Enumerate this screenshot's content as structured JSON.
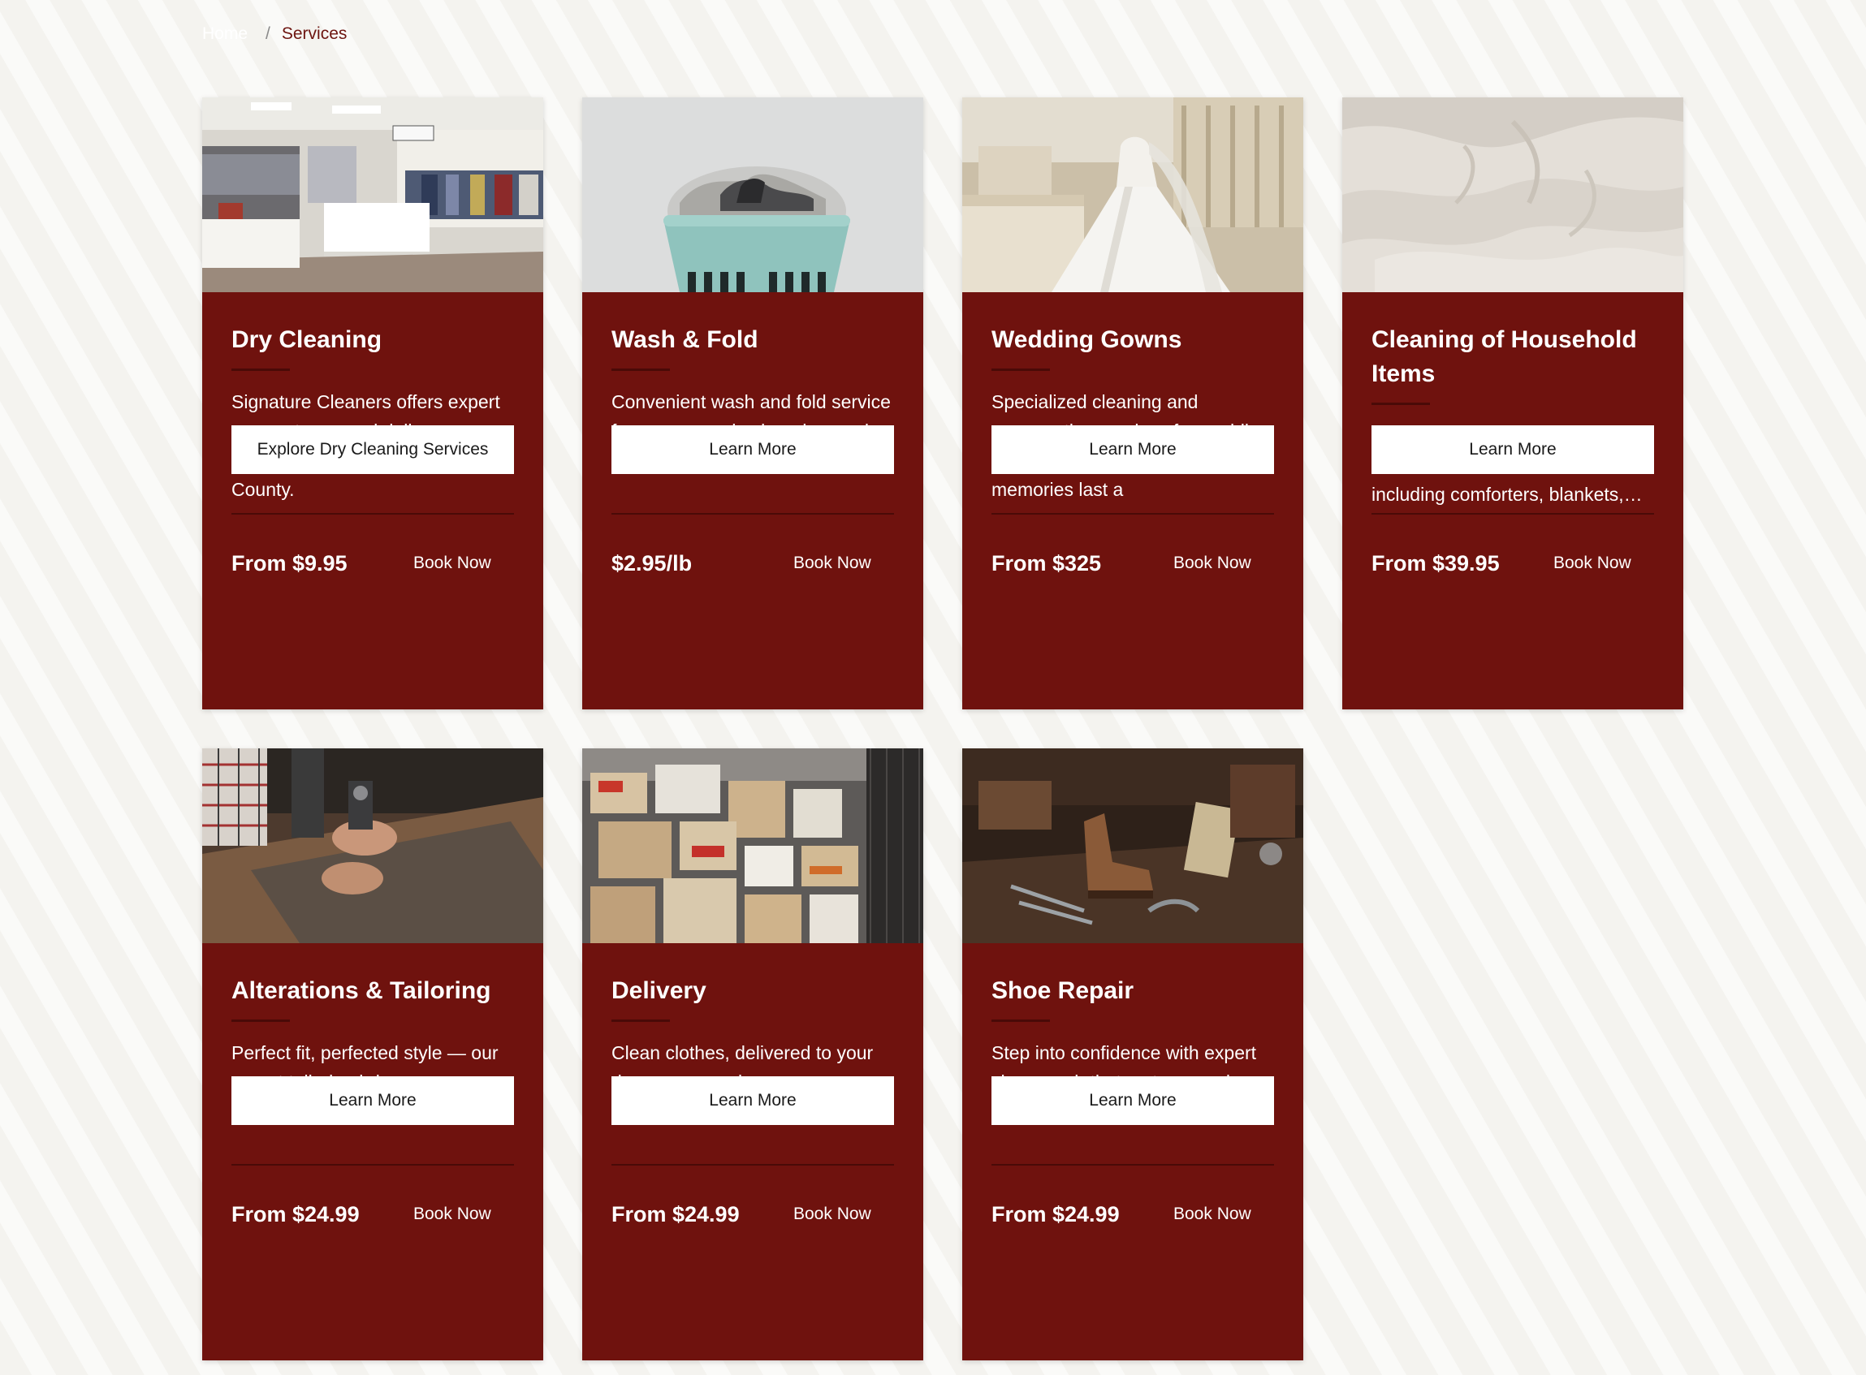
{
  "breadcrumb": {
    "home": "Home",
    "separator": "/",
    "current": "Services"
  },
  "colors": {
    "card_background": "#6f120e",
    "page_background": "#f4f3ef",
    "accent_text": "#6d1510"
  },
  "services": [
    {
      "title": "Dry Cleaning",
      "description": "Signature Cleaners offers expert garment care and delivery services throughout Bucks County.",
      "button_label": "Explore Dry Cleaning Services",
      "price": "From $9.95",
      "book_label": "Book Now",
      "image": "dry-cleaning-shop-photo"
    },
    {
      "title": "Wash & Fold",
      "description": "Convenient wash and fold service for your everyday laundry needs, saving you time and effort.",
      "button_label": "Learn More",
      "price": "$2.95/lb",
      "book_label": "Book Now",
      "image": "laundry-basket-photo"
    },
    {
      "title": "Wedding Gowns",
      "description": "Specialized cleaning and preservation services for wedding gowns, ensuring your precious memories last a",
      "button_label": "Learn More",
      "price": "From $325",
      "book_label": "Book Now",
      "image": "wedding-gown-photo"
    },
    {
      "title": "Cleaning of Household Items",
      "description": "Comprehensive cleaning solutions for household items including comforters, blankets, and more.",
      "button_label": "Learn More",
      "price": "From $39.95",
      "book_label": "Book Now",
      "image": "white-linen-photo"
    },
    {
      "title": "Alterations & Tailoring",
      "description": "Perfect fit, perfected style — our expert tailoring brings your garments to life.",
      "button_label": "Learn More",
      "price": "From $24.99",
      "book_label": "Book Now",
      "image": "tailoring-photo"
    },
    {
      "title": "Delivery",
      "description": "Clean clothes, delivered to your door — convenience you can count on.",
      "button_label": "Learn More",
      "price": "From $24.99",
      "book_label": "Book Now",
      "image": "delivery-boxes-photo"
    },
    {
      "title": "Shoe Repair",
      "description": "Step into confidence with expert shoe repair that restores and revives.",
      "button_label": "Learn More",
      "price": "From $24.99",
      "book_label": "Book Now",
      "image": "shoe-repair-photo"
    }
  ]
}
